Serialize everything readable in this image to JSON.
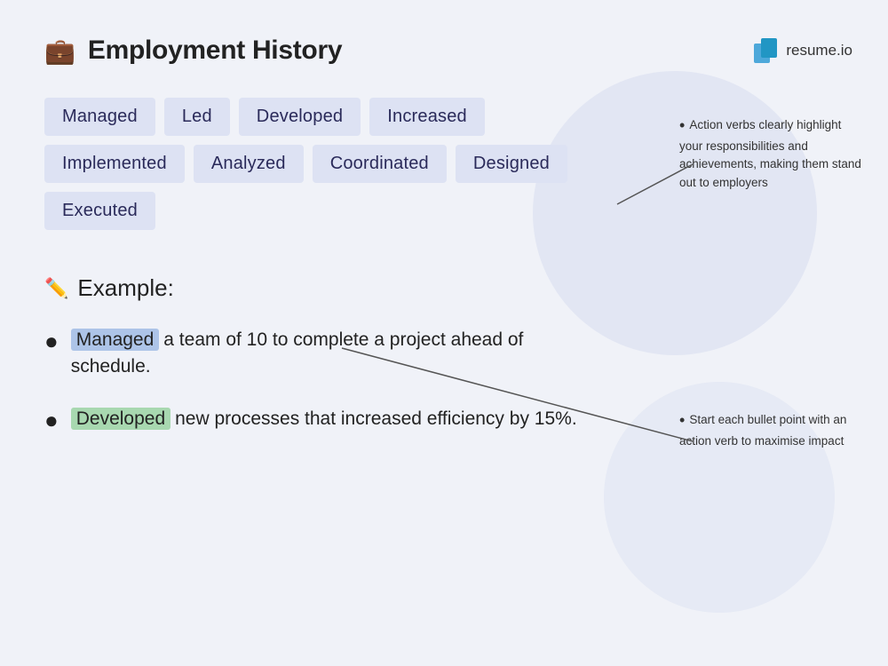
{
  "header": {
    "title": "Employment History",
    "logo_text": "resume.io"
  },
  "verbs": [
    "Managed",
    "Led",
    "Developed",
    "Increased",
    "Implemented",
    "Analyzed",
    "Coordinated",
    "Designed",
    "Executed"
  ],
  "example": {
    "label": "Example:",
    "bullets": [
      {
        "highlight": "Managed",
        "highlight_class": "highlight-blue",
        "text": " a team of 10 to complete a project ahead of schedule."
      },
      {
        "highlight": "Developed",
        "highlight_class": "highlight-green",
        "text": " new processes that increased efficiency by 15%."
      }
    ]
  },
  "annotation1": {
    "text": "Action verbs clearly highlight your responsibilities and achievements, making them stand out to employers"
  },
  "annotation2": {
    "text": "Start each bullet point with an action verb to maximise impact"
  }
}
